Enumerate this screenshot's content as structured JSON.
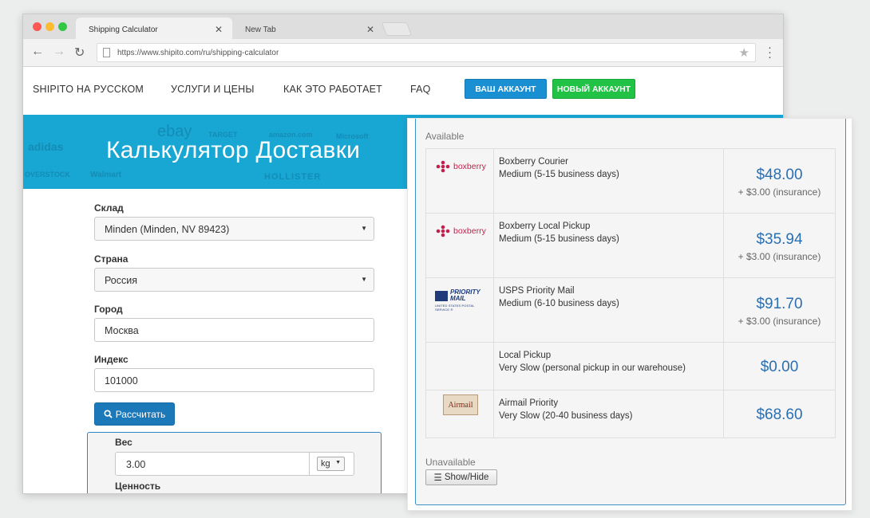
{
  "browser": {
    "tabs": [
      {
        "label": "Shipping Calculator",
        "close": "✕"
      },
      {
        "label": "New Tab",
        "close": "✕"
      }
    ],
    "url": "https://www.shipito.com/ru/shipping-calculator"
  },
  "nav": {
    "links": [
      "SHIPITO НА РУССКОМ",
      "УСЛУГИ И ЦЕНЫ",
      "КАК ЭТО РАБОТАЕТ",
      "FAQ"
    ],
    "account": "ВАШ АККАУНТ",
    "new_account": "НОВЫЙ АККАУНТ"
  },
  "hero": {
    "title": "Калькулятор Доставки",
    "bg_logos": [
      "adidas",
      "ebay",
      "TARGET",
      "amazon.com",
      "Microsoft",
      "HOLLISTER",
      "Walmart",
      "OVERSTOCK"
    ]
  },
  "form": {
    "warehouse": {
      "label": "Склад",
      "value": "Minden (Minden, NV 89423)"
    },
    "country": {
      "label": "Страна",
      "value": "Россия"
    },
    "city": {
      "label": "Город",
      "value": "Москва"
    },
    "zip": {
      "label": "Индекс",
      "value": "101000"
    },
    "calculate": "Рассчитать",
    "weight": {
      "label": "Вес",
      "value": "3.00",
      "unit": "kg"
    },
    "value_label": "Ценность"
  },
  "results": {
    "available_label": "Available",
    "rows": [
      {
        "carrier": "Boxberry Courier",
        "speed": "Medium (5-15 business days)",
        "price": "$48.00",
        "insurance": "+ $3.00 (insurance)",
        "logo": "boxberry"
      },
      {
        "carrier": "Boxberry Local Pickup",
        "speed": "Medium (5-15 business days)",
        "price": "$35.94",
        "insurance": "+ $3.00 (insurance)",
        "logo": "boxberry"
      },
      {
        "carrier": "USPS Priority Mail",
        "speed": "Medium (6-10 business days)",
        "price": "$91.70",
        "insurance": "+ $3.00 (insurance)",
        "logo": "usps"
      },
      {
        "carrier": "Local Pickup",
        "speed": "Very Slow (personal pickup in our warehouse)",
        "price": "$0.00",
        "insurance": "",
        "logo": ""
      },
      {
        "carrier": "Airmail Priority",
        "speed": "Very Slow (20-40 business days)",
        "price": "$68.60",
        "insurance": "",
        "logo": "airmail"
      }
    ],
    "logos": {
      "boxberry": "boxberry",
      "usps_name": "PRIORITY MAIL",
      "usps_sub": "UNITED STATES POSTAL SERVICE ®",
      "airmail": "Airmail"
    },
    "unavailable_label": "Unavailable",
    "show_hide": "Show/Hide"
  },
  "colors": {
    "accent": "#18a6d2",
    "price": "#2a6fb0",
    "account": "#1a8fd1",
    "new_account": "#21c246",
    "calc": "#1b78b9"
  }
}
